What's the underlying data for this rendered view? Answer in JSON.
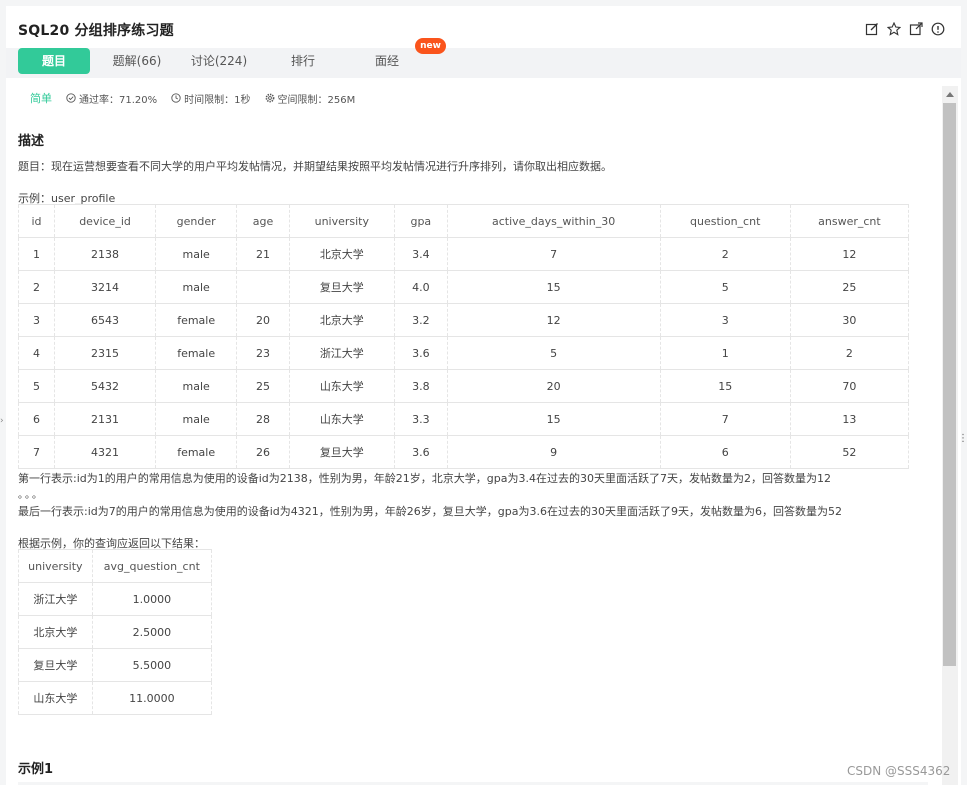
{
  "header": {
    "title": "SQL20  分组排序练习题",
    "icons": [
      "edit-icon",
      "star-icon",
      "external-link-icon",
      "info-icon"
    ]
  },
  "tabs": [
    {
      "label": "题目",
      "active": true
    },
    {
      "label": "题解(66)"
    },
    {
      "label": "讨论(224)"
    },
    {
      "label": "排行"
    },
    {
      "label": "面经"
    }
  ],
  "badge_new": "new",
  "meta": {
    "difficulty": "简单",
    "pass_rate": "通过率：71.20%",
    "time_limit": "时间限制：1秒",
    "space_limit": "空间限制：256M"
  },
  "description": {
    "heading": "描述",
    "question": "题目：现在运营想要查看不同大学的用户平均发帖情况，并期望结果按照平均发帖情况进行升序排列，请你取出相应数据。",
    "example_label": "示例：user_profile",
    "note1": "第一行表示:id为1的用户的常用信息为使用的设备id为2138，性别为男，年龄21岁，北京大学，gpa为3.4在过去的30天里面活跃了7天，发帖数量为2，回答数量为12",
    "ellipsis": "。。。",
    "note2": "最后一行表示:id为7的用户的常用信息为使用的设备id为4321，性别为男，年龄26岁，复旦大学，gpa为3.6在过去的30天里面活跃了9天，发帖数量为6，回答数量为52",
    "result_intro": "根据示例，你的查询应返回以下结果："
  },
  "user_profile_table": {
    "headers": [
      "id",
      "device_id",
      "gender",
      "age",
      "university",
      "gpa",
      "active_days_within_30",
      "question_cnt",
      "answer_cnt"
    ],
    "rows": [
      [
        "1",
        "2138",
        "male",
        "21",
        "北京大学",
        "3.4",
        "7",
        "2",
        "12"
      ],
      [
        "2",
        "3214",
        "male",
        "",
        "复旦大学",
        "4.0",
        "15",
        "5",
        "25"
      ],
      [
        "3",
        "6543",
        "female",
        "20",
        "北京大学",
        "3.2",
        "12",
        "3",
        "30"
      ],
      [
        "4",
        "2315",
        "female",
        "23",
        "浙江大学",
        "3.6",
        "5",
        "1",
        "2"
      ],
      [
        "5",
        "5432",
        "male",
        "25",
        "山东大学",
        "3.8",
        "20",
        "15",
        "70"
      ],
      [
        "6",
        "2131",
        "male",
        "28",
        "山东大学",
        "3.3",
        "15",
        "7",
        "13"
      ],
      [
        "7",
        "4321",
        "female",
        "26",
        "复旦大学",
        "3.6",
        "9",
        "6",
        "52"
      ]
    ]
  },
  "result_table": {
    "headers": [
      "university",
      "avg_question_cnt"
    ],
    "rows": [
      [
        "浙江大学",
        "1.0000"
      ],
      [
        "北京大学",
        "2.5000"
      ],
      [
        "复旦大学",
        "5.5000"
      ],
      [
        "山东大学",
        "11.0000"
      ]
    ]
  },
  "example_heading": "示例1",
  "watermark": "CSDN @SSS4362",
  "colors": {
    "accent": "#32ca99",
    "new_badge": "#fa541c"
  }
}
